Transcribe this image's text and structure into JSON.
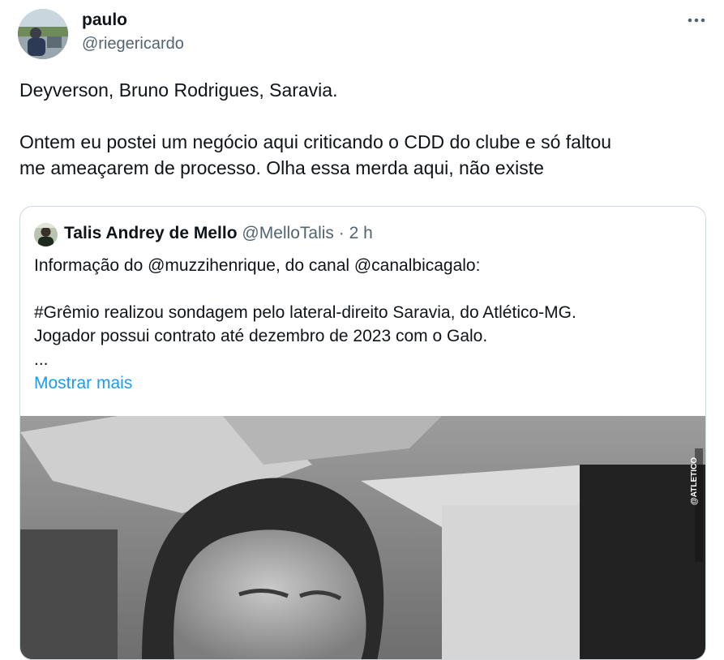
{
  "tweet": {
    "author_name": "paulo",
    "author_handle": "@riegericardo",
    "text_line_1": "Deyverson, Bruno Rodrigues, Saravia.",
    "text_line_2": "Ontem eu postei um negócio aqui criticando o CDD do clube e só faltou",
    "text_line_3": "me ameaçarem de processo. Olha essa merda aqui, não existe",
    "more_icon": "more-horizontal-icon"
  },
  "quoted_tweet": {
    "author_name": "Talis Andrey de Mello",
    "author_handle": "@MelloTalis",
    "separator": "·",
    "time": "2 h",
    "body_line_1": "Informação do @muzzihenrique, do canal @canalbicagalo:",
    "body_line_2": "#Grêmio realizou sondagem pelo lateral-direito Saravia, do Atlético-MG.",
    "body_line_3": "Jogador possui contrato até dezembro de 2023 com o Galo.",
    "body_line_4": "...",
    "show_more_label": "Mostrar mais",
    "media_watermark": "@ATLETICO"
  },
  "colors": {
    "primary_text": "#0f1419",
    "secondary_text": "#536471",
    "link": "#1d9bf0",
    "border": "#cfd9de"
  }
}
